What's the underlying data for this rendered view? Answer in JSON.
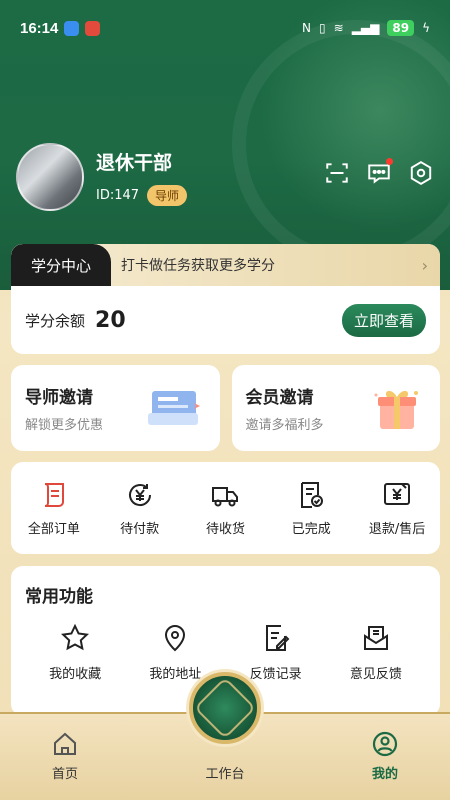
{
  "status_bar": {
    "time": "16:14",
    "battery": "89"
  },
  "profile": {
    "name": "退休干部",
    "id_text": "ID:147",
    "role_badge": "导师"
  },
  "credit": {
    "tab_label": "学分中心",
    "tip": "打卡做任务获取更多学分",
    "balance_label": "学分余额",
    "balance_value": "20",
    "view_button": "立即查看"
  },
  "invites": [
    {
      "title": "导师邀请",
      "subtitle": "解锁更多优惠"
    },
    {
      "title": "会员邀请",
      "subtitle": "邀请多福利多"
    }
  ],
  "orders": [
    {
      "label": "全部订单",
      "icon": "scroll-icon"
    },
    {
      "label": "待付款",
      "icon": "yen-clock-icon"
    },
    {
      "label": "待收货",
      "icon": "truck-icon"
    },
    {
      "label": "已完成",
      "icon": "checked-doc-icon"
    },
    {
      "label": "退款/售后",
      "icon": "refund-icon"
    }
  ],
  "functions": {
    "title": "常用功能",
    "items": [
      {
        "label": "我的收藏",
        "icon": "star-icon"
      },
      {
        "label": "我的地址",
        "icon": "location-icon"
      },
      {
        "label": "反馈记录",
        "icon": "edit-doc-icon"
      },
      {
        "label": "意见反馈",
        "icon": "mail-icon"
      }
    ]
  },
  "bottom_nav": {
    "items": [
      {
        "label": "首页",
        "icon": "home-icon"
      },
      {
        "label": "工作台",
        "icon": "emblem-icon"
      },
      {
        "label": "我的",
        "icon": "user-icon"
      }
    ],
    "active": "我的"
  },
  "colors": {
    "primary_green": "#1b6a44",
    "header_green": "#1d6a45",
    "gold": "#d9b86a",
    "accent_red": "#e0483b",
    "badge_yellow": "#f3c56a"
  }
}
